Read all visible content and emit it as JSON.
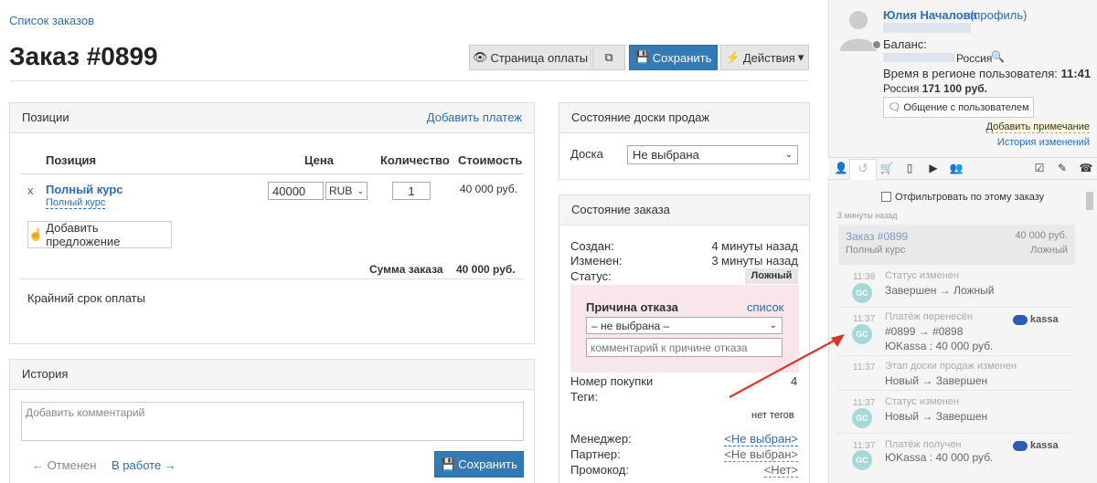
{
  "breadcrumb": "Список заказов",
  "page_title": "Заказ #0899",
  "toolbar": {
    "pay_page": "Страница оплаты",
    "save": "Сохранить",
    "actions": "Действия"
  },
  "positions": {
    "title": "Позиции",
    "add_payment": "Добавить платеж",
    "columns": [
      "Позиция",
      "Цена",
      "Количество",
      "Стоимость"
    ],
    "row": {
      "remove": "x",
      "name": "Полный курс",
      "sub": "Полный курс",
      "price": "40000",
      "currency": "RUB",
      "qty": "1",
      "cost": "40 000 руб."
    },
    "add_offer": "Добавить предложение",
    "sum_label": "Сумма заказа",
    "sum_value": "40 000 руб.",
    "deadline": "Крайний срок оплаты"
  },
  "history": {
    "title": "История",
    "placeholder": "Добавить комментарий",
    "prev": "← Отменен",
    "next": "В работе →",
    "save": "Сохранить"
  },
  "board": {
    "title": "Состояние доски продаж",
    "label": "Доска",
    "value": "Не выбрана"
  },
  "order_state": {
    "title": "Состояние заказа",
    "created_label": "Создан:",
    "created_value": "4 минуты назад",
    "changed_label": "Изменен:",
    "changed_value": "3 минуты назад",
    "status_label": "Статус:",
    "status_value": "Ложный",
    "reason_title": "Причина отказа",
    "reason_list": "список",
    "reason_select": "– не выбрана –",
    "reason_placeholder": "комментарий к причине отказа",
    "purchase_label": "Номер покупки",
    "purchase_value": "4",
    "tags_label": "Теги:",
    "tags_value": "нет тегов",
    "manager_label": "Менеджер:",
    "manager_value": "<Не выбран>",
    "partner_label": "Партнер:",
    "partner_value": "<Не выбран>",
    "promo_label": "Промокод:",
    "promo_value": "<Нет>"
  },
  "user": {
    "name": "Юлия Началова",
    "profile": "(профиль)",
    "balance_label": "Баланс:",
    "country": "Россия",
    "time_label": "Время в регионе пользователя:",
    "time_value": "11:41",
    "summary_country": "Россия",
    "summary_value": "171 100 руб.",
    "chat_btn": "Общение с пользователем",
    "add_note": "Добавить примечание",
    "change_history": "История изменений"
  },
  "feed": {
    "filter": "Отфильтровать по этому заказу",
    "ago": "3 минуты назад",
    "order_link": "Заказ #0899",
    "order_sum": "40 000 руб.",
    "order_product": "Полный курс",
    "order_status": "Ложный",
    "items": [
      {
        "time": "11:38",
        "avatar": "GC",
        "title": "Статус изменен",
        "line1": "Завершен → Ложный",
        "line2": ""
      },
      {
        "time": "11:37",
        "avatar": "GC",
        "title": "Платёж перенесён",
        "line1": "#0899 → #0898",
        "line2": "ЮKassa : 40 000 руб.",
        "logo": "kassa"
      },
      {
        "time": "11:37",
        "avatar": "",
        "title": "Этап доски продаж изменен",
        "line1": "Новый → Завершен",
        "line2": ""
      },
      {
        "time": "11:37",
        "avatar": "GC",
        "title": "Статус изменен",
        "line1": "Новый → Завершен",
        "line2": ""
      },
      {
        "time": "11:37",
        "avatar": "GC",
        "title": "Платёж получен",
        "line1": "ЮKassa : 40 000 руб.",
        "line2": "",
        "logo": "kassa"
      }
    ]
  },
  "colors": {
    "primary": "#337ab7",
    "link": "#2a6ebb",
    "pink": "#f9e6ea",
    "arrow": "#d9362c",
    "avatar": "#a7d8d8"
  }
}
